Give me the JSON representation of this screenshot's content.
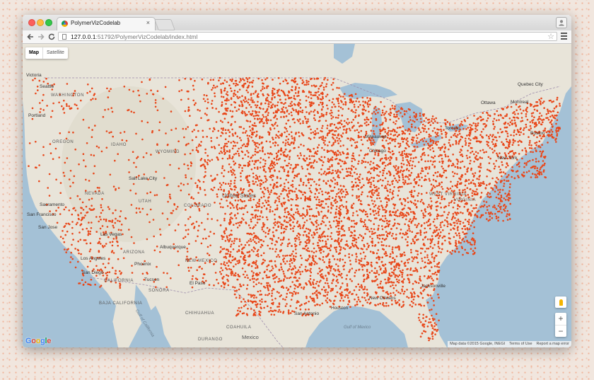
{
  "browser": {
    "tab_title": "PolymerVizCodelab",
    "tab_close": "×",
    "url_host": "127.0.0.1",
    "url_path": ":51792/PolymerVizCodelab/index.html",
    "back_icon": "arrow-left-icon",
    "forward_icon": "arrow-right-icon",
    "reload_icon": "reload-icon",
    "star": "☆",
    "user_glyph": "👤"
  },
  "map": {
    "type_control": {
      "map_label": "Map",
      "satellite_label": "Satellite",
      "selected": "Map"
    },
    "zoom": {
      "in_label": "+",
      "out_label": "−"
    },
    "logo_text": "Google",
    "attribution": {
      "data": "Map data ©2015 Google, INEGI",
      "terms": "Terms of Use",
      "report": "Report a map error"
    },
    "marker_color": "#e8471a",
    "labels": {
      "victoria": "Victoria",
      "seattle": "Seattle",
      "washington": "WASHINGTON",
      "portland": "Portland",
      "oregon": "OREGON",
      "idaho": "IDAHO",
      "wyoming": "WYOMING",
      "nevada": "NEVADA",
      "utah": "UTAH",
      "salt_lake_city": "Salt Lake City",
      "colorado": "COLORADO",
      "united_states": "United States",
      "sacramento": "Sacramento",
      "san_francisco": "San Francisco",
      "san_jose": "San Jose",
      "las_vegas": "Las Vegas",
      "california": "CALIFORNIA",
      "los_angeles": "Los Angeles",
      "san_diego": "San Diego",
      "arizona": "ARIZONA",
      "phoenix": "Phoenix",
      "albuquerque": "Albuquerque",
      "new_mexico": "NEW MEXICO",
      "tucson": "Tucson",
      "el_paso": "El Paso",
      "baja_california": "BAJA CALIFORNIA",
      "sonora": "SONORA",
      "chihuahua": "CHIHUAHUA",
      "coahuila": "COAHUILA",
      "durango": "DURANGO",
      "mexico": "Mexico",
      "gulf_of_california": "Gulf of California",
      "gulf_of_mexico": "Gulf of Mexico",
      "quebec_city": "Quebec City",
      "ottawa": "Ottawa",
      "montreal": "Montreal",
      "toronto": "Toronto",
      "milwaukee": "Milwaukee",
      "chicago": "Chicago",
      "boston": "Boston",
      "new_york": "New York",
      "west_virginia": "WEST VIRGINIA",
      "virginia": "VIRGINIA",
      "jacksonville": "Jacksonville",
      "houston": "Houston",
      "san_antonio": "San Antonio",
      "new_orleans": "New Orleans"
    }
  }
}
